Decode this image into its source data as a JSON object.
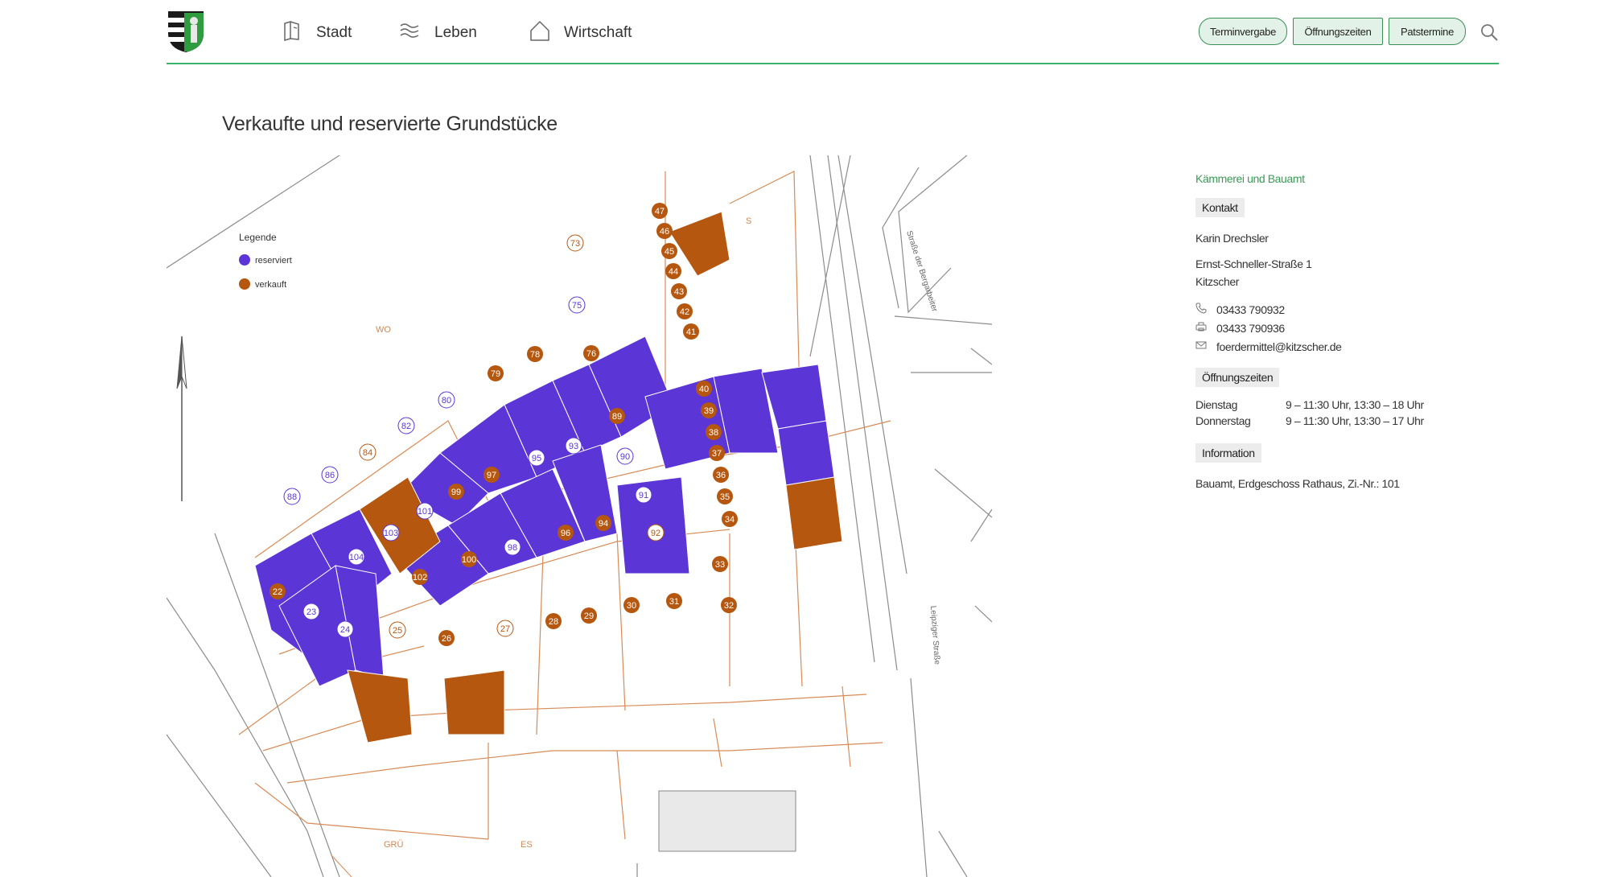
{
  "header": {
    "nav": [
      {
        "label": "Stadt",
        "icon": "map-icon"
      },
      {
        "label": "Leben",
        "icon": "waves-icon"
      },
      {
        "label": "Wirtschaft",
        "icon": "house-icon"
      }
    ],
    "buttons": [
      "Terminvergabe",
      "Öffnungszeiten",
      "Patstermine"
    ]
  },
  "page": {
    "title": "Verkaufte und reservierte Grundstücke"
  },
  "map": {
    "legend_title": "Legende",
    "legend_items": [
      {
        "label": "reserviert",
        "color": "#5b35d5"
      },
      {
        "label": "verkauft",
        "color": "#b5570f"
      }
    ],
    "colors": {
      "reserved": "#5b35d5",
      "sold": "#b5570f",
      "lines": "#d88b56",
      "grey": "#8c8c8c"
    },
    "reserved_plots": [
      "75",
      "80",
      "82",
      "86",
      "88",
      "95",
      "93",
      "90",
      "91",
      "101",
      "103",
      "104",
      "98",
      "23",
      "24"
    ],
    "sold_plots": [
      "73",
      "84",
      "92",
      "25",
      "27"
    ],
    "plot_numbers": [
      "47",
      "46",
      "45",
      "44",
      "43",
      "42",
      "41",
      "79",
      "78",
      "76",
      "40",
      "39",
      "38",
      "37",
      "36",
      "35",
      "34",
      "89",
      "97",
      "99",
      "100",
      "102",
      "96",
      "94",
      "33",
      "32",
      "31",
      "30",
      "29",
      "28",
      "26",
      "22"
    ],
    "street_labels": [
      "Straße der Bergarbeiter",
      "Leipziger Straße"
    ],
    "labels": [
      "WO",
      "GRÜ",
      "ES",
      "S"
    ]
  },
  "sidebar": {
    "department": "Kämmerei und Bauamt",
    "contact_label": "Kontakt",
    "name": "Karin Drechsler",
    "address_line1": "Ernst-Schneller-Straße 1",
    "address_line2": "Kitzscher",
    "phone": "03433 790932",
    "fax": "03433 790936",
    "email": "foerdermittel@kitzscher.de",
    "hours_label": "Öffnungszeiten",
    "hours": [
      {
        "day": "Dienstag",
        "time": "9 – 11:30 Uhr, 13:30 – 18 Uhr"
      },
      {
        "day": "Donnerstag",
        "time": "9 – 11:30 Uhr, 13:30 – 17 Uhr"
      }
    ],
    "info_label": "Information",
    "info_text": "Bauamt, Erdgeschoss Rathaus, Zi.-Nr.: 101"
  }
}
